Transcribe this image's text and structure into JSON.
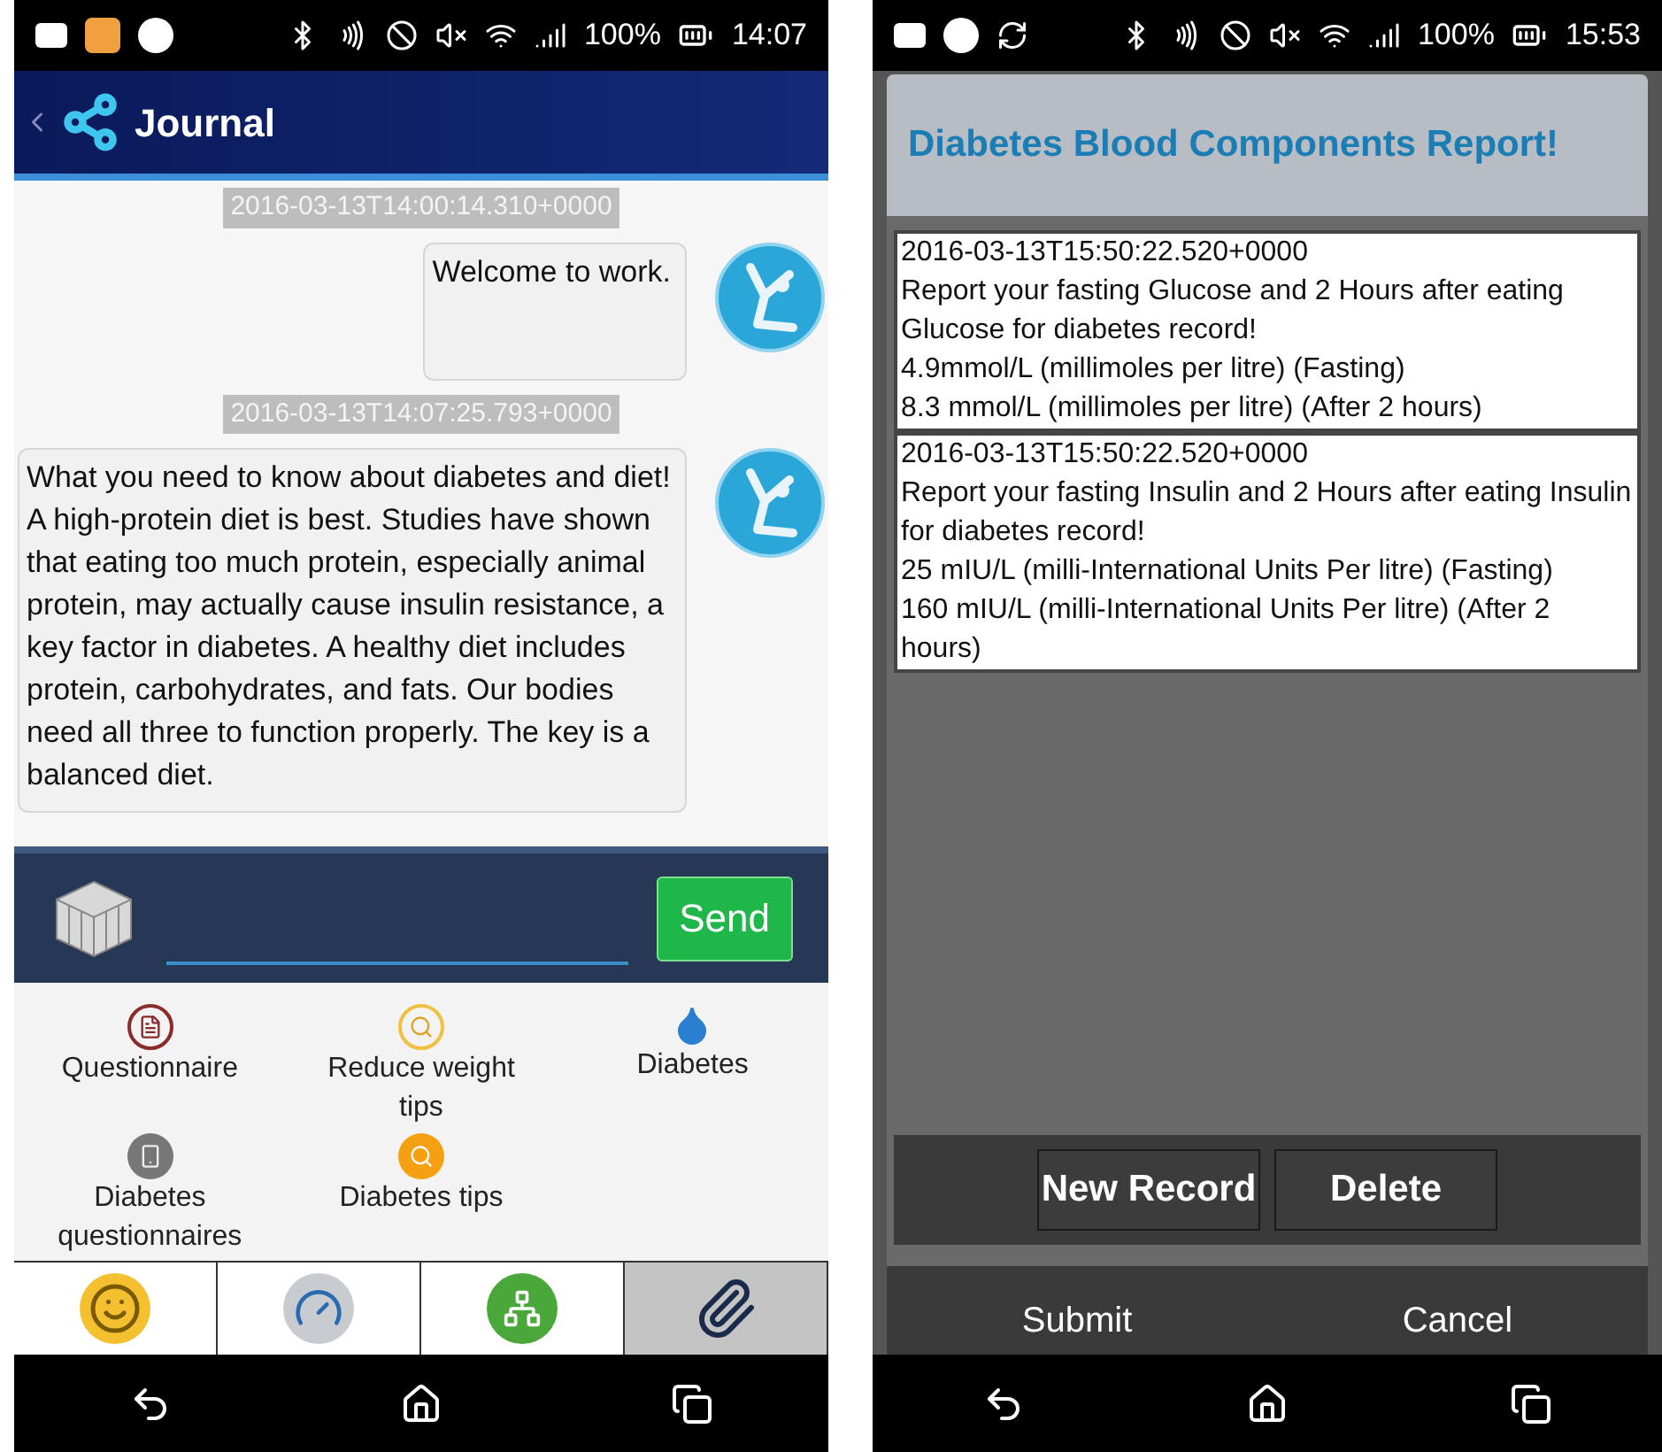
{
  "left_screen": {
    "status_bar": {
      "battery": "100%",
      "time": "14:07"
    },
    "header": {
      "title": "Journal"
    },
    "messages": [
      {
        "timestamp": "2016-03-13T14:00:14.310+0000",
        "text": "Welcome to work."
      },
      {
        "timestamp": "2016-03-13T14:07:25.793+0000",
        "text": "What you need to know about diabetes and diet! A high-protein diet is best. Studies have shown that eating too much protein, especially animal protein, may actually cause insulin resistance, a key factor in diabetes. A healthy diet includes protein, carbohydrates, and fats. Our bodies need all three to function properly. The key is a balanced diet."
      }
    ],
    "composer": {
      "send_button": "Send"
    },
    "shortcuts": [
      {
        "kind": "document",
        "label": "Questionnaire"
      },
      {
        "kind": "search",
        "label": "Reduce weight tips"
      },
      {
        "kind": "drop",
        "label": "Diabetes"
      },
      {
        "kind": "phone",
        "label": "Diabetes questionnaires"
      },
      {
        "kind": "search-filled",
        "label": "Diabetes tips"
      }
    ],
    "tabs": [
      {
        "kind": "smiley",
        "selected": false
      },
      {
        "kind": "gauge",
        "selected": false
      },
      {
        "kind": "network",
        "selected": false
      },
      {
        "kind": "paperclip",
        "selected": true
      }
    ]
  },
  "right_screen": {
    "status_bar": {
      "battery": "100%",
      "time": "15:53"
    },
    "dialog": {
      "title": "Diabetes Blood Components Report!",
      "records": [
        {
          "timestamp": "2016-03-13T15:50:22.520+0000",
          "prompt": "Report your fasting Glucose and 2 Hours after eating Glucose for diabetes record!",
          "readings": [
            "4.9mmol/L (millimoles per litre) (Fasting)",
            "8.3 mmol/L (millimoles per litre) (After 2 hours)"
          ]
        },
        {
          "timestamp": "2016-03-13T15:50:22.520+0000",
          "prompt": "Report your fasting Insulin and 2 Hours after eating Insulin for diabetes record!",
          "readings": [
            "25 mIU/L (milli-International Units Per litre) (Fasting)",
            "160 mIU/L (milli-International Units Per litre) (After 2 hours)"
          ]
        }
      ],
      "actions": [
        "New Record",
        "Delete"
      ],
      "buttons": [
        "Submit",
        "Cancel"
      ]
    }
  }
}
